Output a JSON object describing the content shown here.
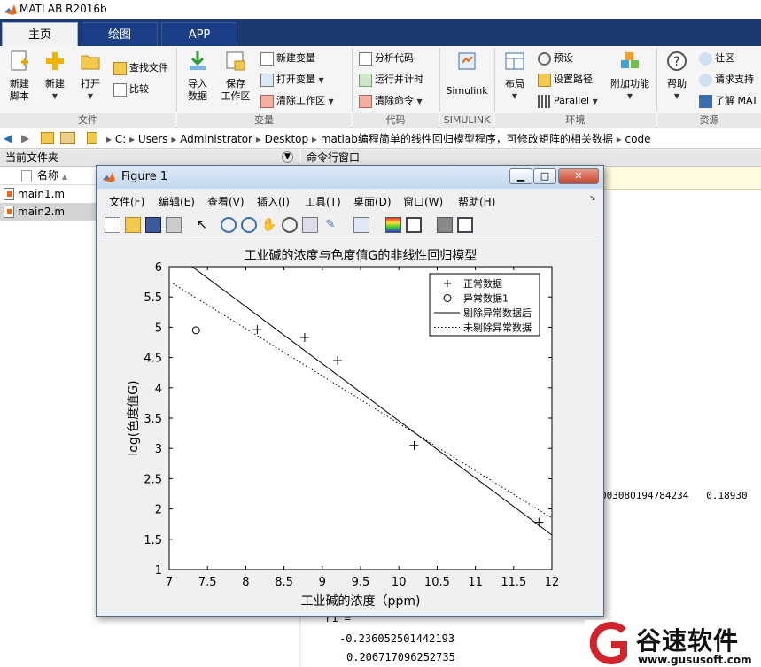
{
  "app": {
    "title": "MATLAB R2016b"
  },
  "tabs": [
    {
      "label": "主页"
    },
    {
      "label": "绘图"
    },
    {
      "label": "APP"
    }
  ],
  "ribbon": {
    "file": {
      "new_script": "新建\n脚本",
      "new": "新建",
      "open": "打开",
      "find_files": "查找文件",
      "compare": "比较",
      "group": "文件"
    },
    "variable": {
      "import": "导入\n数据",
      "save": "保存\n工作区",
      "new_var": "新建变量",
      "open_var": "打开变量",
      "clear_ws": "清除工作区",
      "group": "变量"
    },
    "code": {
      "analyze": "分析代码",
      "run_time": "运行并计时",
      "clear_cmd": "清除命令",
      "group": "代码"
    },
    "simulink": {
      "label": "Simulink",
      "group": "SIMULINK"
    },
    "env": {
      "layout": "布局",
      "prefs": "预设",
      "set_path": "设置路径",
      "parallel": "Parallel",
      "addons": "附加功能",
      "group": "环境"
    },
    "resources": {
      "help": "帮助",
      "community": "社区",
      "support": "请求支持",
      "learn": "了解 MAT",
      "group": "资源"
    }
  },
  "address": {
    "crumbs": [
      "C:",
      "Users",
      "Administrator",
      "Desktop",
      "matlab编程简单的线性回归模型程序，可修改矩阵的相关数据",
      "code"
    ]
  },
  "file_panel": {
    "title": "当前文件夹",
    "col_name": "名称",
    "files": [
      {
        "name": "main1.m",
        "selected": false
      },
      {
        "name": "main2.m",
        "selected": true
      }
    ]
  },
  "command_window": {
    "title": "命令行窗口",
    "output_mid": "003080194784234   0.18930",
    "var_label": "r1 =",
    "values": [
      "-0.236052501442193",
      "0.206717096252735"
    ]
  },
  "figure": {
    "title": "Figure 1",
    "menu": [
      "文件(F)",
      "编辑(E)",
      "查看(V)",
      "插入(I)",
      "工具(T)",
      "桌面(D)",
      "窗口(W)",
      "帮助(H)"
    ]
  },
  "chart_data": {
    "type": "scatter",
    "title": "工业碱的浓度与色度值G的非线性回归模型",
    "xlabel": "工业碱的浓度（ppm)",
    "ylabel": "log(色度值G)",
    "xlim": [
      7,
      12
    ],
    "ylim": [
      1,
      6
    ],
    "xticks": [
      "7",
      "7.5",
      "8",
      "8.5",
      "9",
      "9.5",
      "10",
      "10.5",
      "11",
      "11.5",
      "12"
    ],
    "yticks": [
      "1",
      "1.5",
      "2",
      "2.5",
      "3",
      "3.5",
      "4",
      "4.5",
      "5",
      "5.5",
      "6"
    ],
    "legend_position": "top-right",
    "series": [
      {
        "name": "正常数据",
        "kind": "plus",
        "points": [
          [
            8.15,
            4.96
          ],
          [
            8.77,
            4.83
          ],
          [
            9.2,
            4.45
          ],
          [
            10.2,
            3.05
          ],
          [
            11.83,
            1.78
          ]
        ]
      },
      {
        "name": "异常数据1",
        "kind": "circle",
        "points": [
          [
            7.35,
            4.95
          ]
        ]
      },
      {
        "name": "剔除异常数据后",
        "kind": "solid",
        "points": [
          [
            7.3,
            6.0
          ],
          [
            12.0,
            1.57
          ]
        ]
      },
      {
        "name": "未剔除异常数据",
        "kind": "dotted",
        "points": [
          [
            7.05,
            5.72
          ],
          [
            12.0,
            1.85
          ]
        ]
      }
    ]
  },
  "watermark": {
    "brand": "谷速软件",
    "url": "www.gususoft.com"
  },
  "colors": {
    "tabbar": "#1c3a70",
    "matlab_orange": "#e66a1c",
    "watermark_red": "#d2222a"
  }
}
